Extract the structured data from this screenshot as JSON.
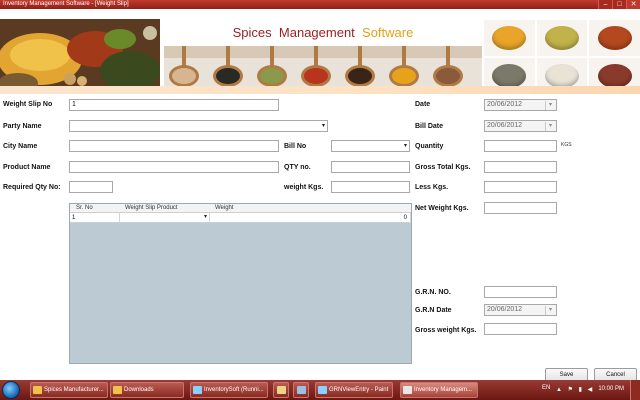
{
  "window": {
    "title": "Inventory Management Software - [Weight Slip]",
    "controls": {
      "minimize": "–",
      "maximize": "□",
      "close": "✕"
    }
  },
  "header": {
    "brand_words": [
      "Spices",
      "Management",
      "Software"
    ],
    "colors": {
      "brand_red": "#9a1e1e",
      "brand_gold": "#e0a21a"
    },
    "bowl_colors": [
      "#e8a52a",
      "#c2b24a",
      "#b4481e",
      "#7b7a6a",
      "#e9e3d6",
      "#8a3a2a"
    ]
  },
  "form": {
    "weight_slip_no": {
      "label": "Weight Slip No",
      "value": "1"
    },
    "party_name": {
      "label": "Party Name",
      "value": ""
    },
    "city_name": {
      "label": "City Name",
      "value": ""
    },
    "product_name": {
      "label": "Product Name",
      "value": ""
    },
    "required_qty": {
      "label": "Required Qty No:",
      "value": ""
    },
    "bill_no": {
      "label": "Bill No",
      "value": ""
    },
    "qty_no": {
      "label": "QTY no.",
      "value": ""
    },
    "weight_kgs": {
      "label": "weight Kgs.",
      "value": ""
    }
  },
  "right": {
    "date": {
      "label": "Date",
      "value": "20/06/2012"
    },
    "bill_date": {
      "label": "Bill Date",
      "value": "20/06/2012"
    },
    "quantity": {
      "label": "Quantity",
      "value": "",
      "unit": "KGS"
    },
    "gross_total": {
      "label": "Gross Total Kgs.",
      "value": ""
    },
    "less_kgs": {
      "label": "Less Kgs.",
      "value": ""
    },
    "net_weight": {
      "label": "Net Weight Kgs.",
      "value": ""
    },
    "grn_no": {
      "label": "G.R.N. NO.",
      "value": ""
    },
    "grn_date": {
      "label": "G.R.N Date",
      "value": "20/06/2012"
    },
    "gross_weight": {
      "label": "Gross weight Kgs.",
      "value": ""
    }
  },
  "grid": {
    "columns": [
      "Sr. No",
      "Weight Slip Product",
      "Weight"
    ],
    "rows": [
      {
        "sr": "1",
        "product": "",
        "weight": "0"
      }
    ]
  },
  "buttons": {
    "save": "Save",
    "cancel": "Cancel"
  },
  "taskbar": {
    "items": [
      {
        "label": "Spices Manufacturer...",
        "icon_color": "#f0c24a"
      },
      {
        "label": "Downloads",
        "icon_color": "#f0c24a"
      },
      {
        "label": "InventorySoft (Runni...",
        "icon_color": "#8bd1ff"
      },
      {
        "label": "",
        "icon_color": "#e9d48a"
      },
      {
        "label": "",
        "icon_color": "#9dbfe2"
      },
      {
        "label": "GRNViewEntry - Paint",
        "icon_color": "#8bd1ff"
      },
      {
        "label": "Inventory Managem...",
        "icon_color": "#e7e7e7"
      }
    ],
    "lang": "EN",
    "tray_icons": "▲ ⚑ ▮ ◀",
    "clock": "10:00 PM"
  }
}
